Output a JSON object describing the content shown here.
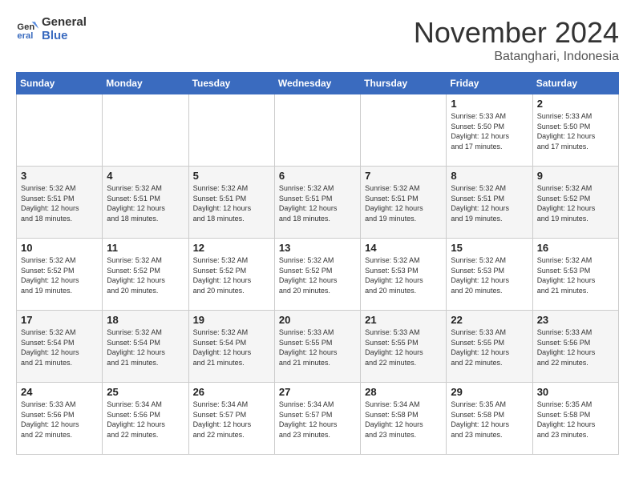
{
  "header": {
    "logo_line1": "General",
    "logo_line2": "Blue",
    "month": "November 2024",
    "location": "Batanghari, Indonesia"
  },
  "weekdays": [
    "Sunday",
    "Monday",
    "Tuesday",
    "Wednesday",
    "Thursday",
    "Friday",
    "Saturday"
  ],
  "weeks": [
    [
      {
        "day": "",
        "content": ""
      },
      {
        "day": "",
        "content": ""
      },
      {
        "day": "",
        "content": ""
      },
      {
        "day": "",
        "content": ""
      },
      {
        "day": "",
        "content": ""
      },
      {
        "day": "1",
        "content": "Sunrise: 5:33 AM\nSunset: 5:50 PM\nDaylight: 12 hours\nand 17 minutes."
      },
      {
        "day": "2",
        "content": "Sunrise: 5:33 AM\nSunset: 5:50 PM\nDaylight: 12 hours\nand 17 minutes."
      }
    ],
    [
      {
        "day": "3",
        "content": "Sunrise: 5:32 AM\nSunset: 5:51 PM\nDaylight: 12 hours\nand 18 minutes."
      },
      {
        "day": "4",
        "content": "Sunrise: 5:32 AM\nSunset: 5:51 PM\nDaylight: 12 hours\nand 18 minutes."
      },
      {
        "day": "5",
        "content": "Sunrise: 5:32 AM\nSunset: 5:51 PM\nDaylight: 12 hours\nand 18 minutes."
      },
      {
        "day": "6",
        "content": "Sunrise: 5:32 AM\nSunset: 5:51 PM\nDaylight: 12 hours\nand 18 minutes."
      },
      {
        "day": "7",
        "content": "Sunrise: 5:32 AM\nSunset: 5:51 PM\nDaylight: 12 hours\nand 19 minutes."
      },
      {
        "day": "8",
        "content": "Sunrise: 5:32 AM\nSunset: 5:51 PM\nDaylight: 12 hours\nand 19 minutes."
      },
      {
        "day": "9",
        "content": "Sunrise: 5:32 AM\nSunset: 5:52 PM\nDaylight: 12 hours\nand 19 minutes."
      }
    ],
    [
      {
        "day": "10",
        "content": "Sunrise: 5:32 AM\nSunset: 5:52 PM\nDaylight: 12 hours\nand 19 minutes."
      },
      {
        "day": "11",
        "content": "Sunrise: 5:32 AM\nSunset: 5:52 PM\nDaylight: 12 hours\nand 20 minutes."
      },
      {
        "day": "12",
        "content": "Sunrise: 5:32 AM\nSunset: 5:52 PM\nDaylight: 12 hours\nand 20 minutes."
      },
      {
        "day": "13",
        "content": "Sunrise: 5:32 AM\nSunset: 5:52 PM\nDaylight: 12 hours\nand 20 minutes."
      },
      {
        "day": "14",
        "content": "Sunrise: 5:32 AM\nSunset: 5:53 PM\nDaylight: 12 hours\nand 20 minutes."
      },
      {
        "day": "15",
        "content": "Sunrise: 5:32 AM\nSunset: 5:53 PM\nDaylight: 12 hours\nand 20 minutes."
      },
      {
        "day": "16",
        "content": "Sunrise: 5:32 AM\nSunset: 5:53 PM\nDaylight: 12 hours\nand 21 minutes."
      }
    ],
    [
      {
        "day": "17",
        "content": "Sunrise: 5:32 AM\nSunset: 5:54 PM\nDaylight: 12 hours\nand 21 minutes."
      },
      {
        "day": "18",
        "content": "Sunrise: 5:32 AM\nSunset: 5:54 PM\nDaylight: 12 hours\nand 21 minutes."
      },
      {
        "day": "19",
        "content": "Sunrise: 5:32 AM\nSunset: 5:54 PM\nDaylight: 12 hours\nand 21 minutes."
      },
      {
        "day": "20",
        "content": "Sunrise: 5:33 AM\nSunset: 5:55 PM\nDaylight: 12 hours\nand 21 minutes."
      },
      {
        "day": "21",
        "content": "Sunrise: 5:33 AM\nSunset: 5:55 PM\nDaylight: 12 hours\nand 22 minutes."
      },
      {
        "day": "22",
        "content": "Sunrise: 5:33 AM\nSunset: 5:55 PM\nDaylight: 12 hours\nand 22 minutes."
      },
      {
        "day": "23",
        "content": "Sunrise: 5:33 AM\nSunset: 5:56 PM\nDaylight: 12 hours\nand 22 minutes."
      }
    ],
    [
      {
        "day": "24",
        "content": "Sunrise: 5:33 AM\nSunset: 5:56 PM\nDaylight: 12 hours\nand 22 minutes."
      },
      {
        "day": "25",
        "content": "Sunrise: 5:34 AM\nSunset: 5:56 PM\nDaylight: 12 hours\nand 22 minutes."
      },
      {
        "day": "26",
        "content": "Sunrise: 5:34 AM\nSunset: 5:57 PM\nDaylight: 12 hours\nand 22 minutes."
      },
      {
        "day": "27",
        "content": "Sunrise: 5:34 AM\nSunset: 5:57 PM\nDaylight: 12 hours\nand 23 minutes."
      },
      {
        "day": "28",
        "content": "Sunrise: 5:34 AM\nSunset: 5:58 PM\nDaylight: 12 hours\nand 23 minutes."
      },
      {
        "day": "29",
        "content": "Sunrise: 5:35 AM\nSunset: 5:58 PM\nDaylight: 12 hours\nand 23 minutes."
      },
      {
        "day": "30",
        "content": "Sunrise: 5:35 AM\nSunset: 5:58 PM\nDaylight: 12 hours\nand 23 minutes."
      }
    ]
  ]
}
